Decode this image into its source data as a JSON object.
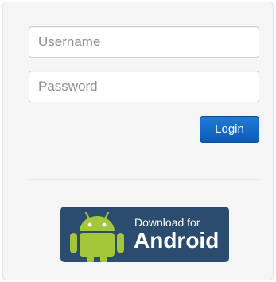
{
  "login_form": {
    "username": {
      "value": "",
      "placeholder": "Username"
    },
    "password": {
      "value": "",
      "placeholder": "Password"
    },
    "login_label": "Login"
  },
  "download_badge": {
    "line1": "Download for",
    "line2": "Android",
    "icon": "android-robot-icon",
    "colors": {
      "badge_background": "#2b4b6f",
      "android_green": "#a4c639"
    }
  },
  "colors": {
    "panel_background": "#f5f5f5",
    "login_button": "#0b5cb3"
  }
}
